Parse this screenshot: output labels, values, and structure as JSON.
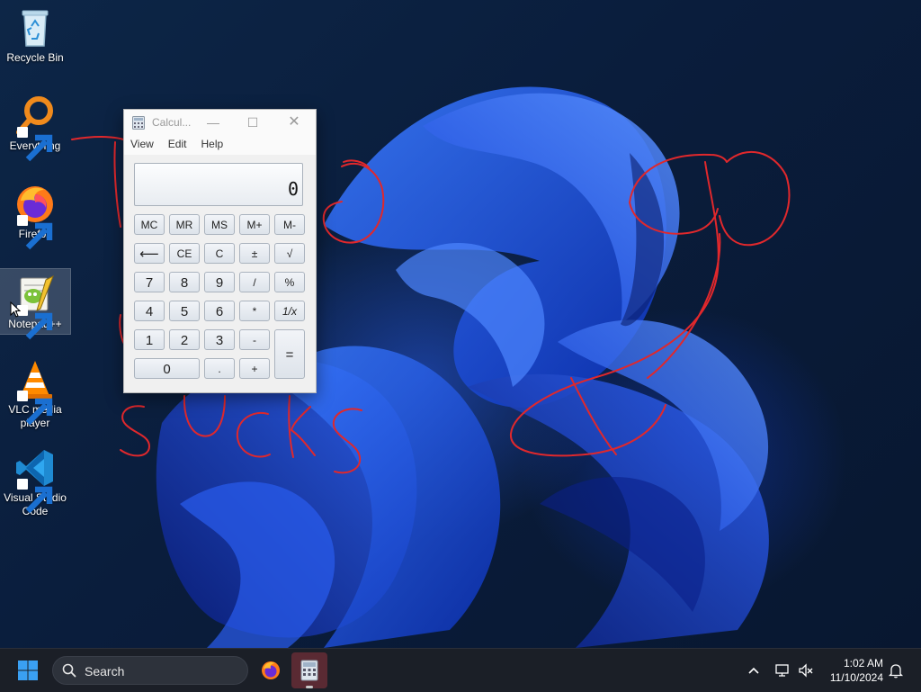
{
  "desktop": {
    "icons": [
      {
        "label": "Recycle Bin",
        "icon": "recycle-bin-icon"
      },
      {
        "label": "Everything",
        "icon": "everything-search-icon"
      },
      {
        "label": "Firefox",
        "icon": "firefox-icon"
      },
      {
        "label": "Notepad++",
        "icon": "notepad-plus-plus-icon"
      },
      {
        "label": "VLC media player",
        "icon": "vlc-cone-icon"
      },
      {
        "label": "Visual Studio Code",
        "icon": "vscode-icon"
      }
    ],
    "handwritten_annotation": "SUCKS",
    "annotation_color": "#e0282c"
  },
  "calculator": {
    "title": "Calcul...",
    "menu": [
      "View",
      "Edit",
      "Help"
    ],
    "display_value": "0",
    "buttons": {
      "mc": "MC",
      "mr": "MR",
      "ms": "MS",
      "mplus": "M+",
      "mminus": "M-",
      "backspace": "⟵",
      "ce": "CE",
      "c": "C",
      "plusminus": "±",
      "sqrt": "√",
      "n7": "7",
      "n8": "8",
      "n9": "9",
      "divide": "/",
      "percent": "%",
      "n4": "4",
      "n5": "5",
      "n6": "6",
      "multiply": "*",
      "reciprocal": "1/x",
      "n1": "1",
      "n2": "2",
      "n3": "3",
      "minus": "-",
      "equals": "=",
      "n0": "0",
      "decimal": ".",
      "plus": "+"
    }
  },
  "taskbar": {
    "search_placeholder": "Search",
    "pinned": [
      {
        "name": "firefox",
        "icon": "firefox-icon"
      },
      {
        "name": "calculator",
        "icon": "calculator-icon",
        "active": true
      }
    ],
    "clock": {
      "time": "1:02 AM",
      "date": "11/10/2024"
    },
    "colors": {
      "taskbar": "#1b1f27",
      "start_blue": "#3aa0f3"
    }
  }
}
